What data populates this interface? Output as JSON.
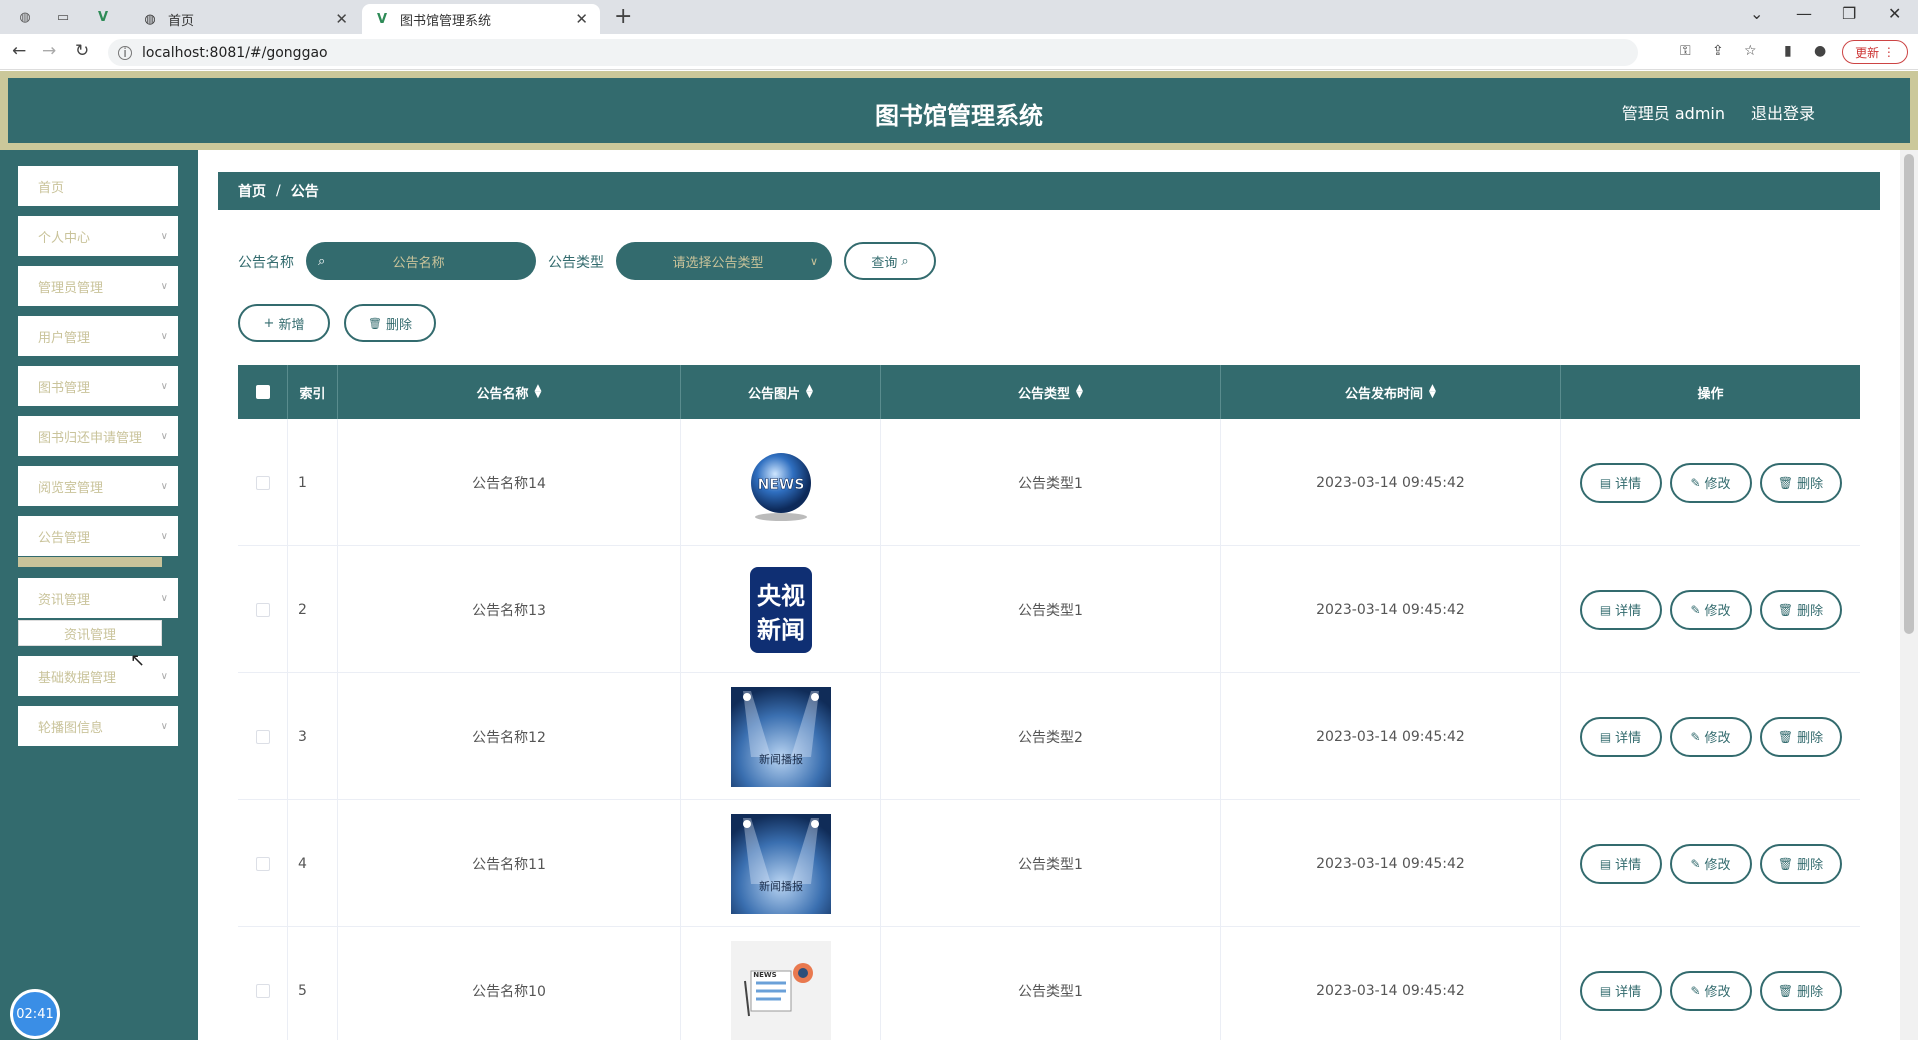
{
  "browser": {
    "tabs": [
      {
        "title": "首页"
      },
      {
        "title": "图书馆管理系统"
      }
    ],
    "url": "localhost:8081/#/gonggao",
    "update_label": "更新"
  },
  "header": {
    "title": "图书馆管理系统",
    "admin_label": "管理员 admin",
    "logout_label": "退出登录"
  },
  "sidebar": {
    "items": [
      {
        "label": "首页"
      },
      {
        "label": "个人中心"
      },
      {
        "label": "管理员管理"
      },
      {
        "label": "用户管理"
      },
      {
        "label": "图书管理"
      },
      {
        "label": "图书归还申请管理"
      },
      {
        "label": "阅览室管理"
      },
      {
        "label": "公告管理"
      },
      {
        "label": "资讯管理"
      },
      {
        "label": "基础数据管理"
      },
      {
        "label": "轮播图信息"
      }
    ],
    "submenu_label": "资讯管理"
  },
  "clock": "02:41",
  "breadcrumb": {
    "home": "首页",
    "sep": "/",
    "current": "公告"
  },
  "filters": {
    "name_label": "公告名称",
    "name_placeholder": "公告名称",
    "type_label": "公告类型",
    "type_placeholder": "请选择公告类型",
    "query_label": "查询"
  },
  "actions": {
    "add_label": "新增",
    "delete_label": "删除"
  },
  "table": {
    "columns": [
      "索引",
      "公告名称",
      "公告图片",
      "公告类型",
      "公告发布时间",
      "操作"
    ],
    "row_actions": {
      "detail": "详情",
      "edit": "修改",
      "delete": "删除"
    },
    "rows": [
      {
        "index": "1",
        "name": "公告名称14",
        "image": "news-globe-image",
        "type": "公告类型1",
        "time": "2023-03-14 09:45:42"
      },
      {
        "index": "2",
        "name": "公告名称13",
        "image": "cctv-news-logo",
        "type": "公告类型1",
        "time": "2023-03-14 09:45:42"
      },
      {
        "index": "3",
        "name": "公告名称12",
        "image": "stage-spotlight-image",
        "type": "公告类型2",
        "time": "2023-03-14 09:45:42"
      },
      {
        "index": "4",
        "name": "公告名称11",
        "image": "stage-spotlight-image",
        "type": "公告类型1",
        "time": "2023-03-14 09:45:42"
      },
      {
        "index": "5",
        "name": "公告名称10",
        "image": "news-paper-image",
        "type": "公告类型1",
        "time": "2023-03-14 09:45:42"
      }
    ]
  },
  "image_text": {
    "news_globe": "NEWS",
    "cctv_top": "央视",
    "cctv_bottom": "新闻",
    "stage": "新闻播报",
    "paper": "NEWS"
  },
  "colors": {
    "primary": "#336b6e",
    "accent": "#c9c39a"
  }
}
